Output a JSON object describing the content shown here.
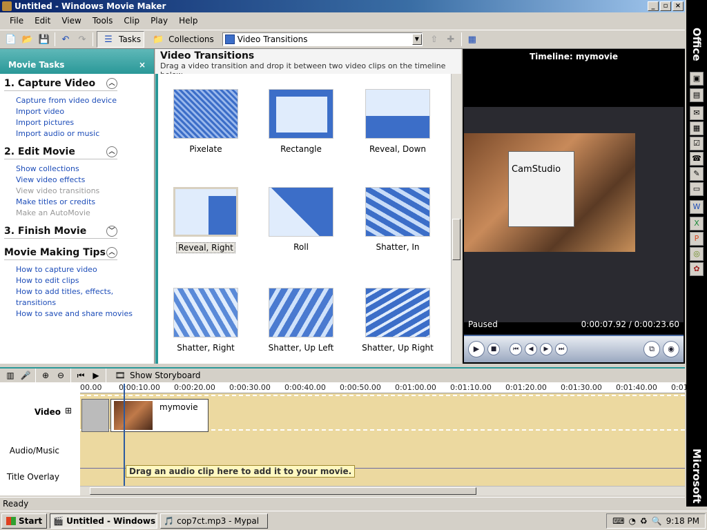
{
  "window": {
    "title": "Untitled - Windows Movie Maker"
  },
  "menu": [
    "File",
    "Edit",
    "View",
    "Tools",
    "Clip",
    "Play",
    "Help"
  ],
  "toolbar": {
    "tasks_label": "Tasks",
    "collections_label": "Collections",
    "collection_select": "Video Transitions"
  },
  "task_pane": {
    "title": "Movie Tasks",
    "close": "×",
    "groups": [
      {
        "title": "1. Capture Video",
        "links": [
          "Capture from video device",
          "Import video",
          "Import pictures",
          "Import audio or music"
        ]
      },
      {
        "title": "2. Edit Movie",
        "links": [
          "Show collections",
          "View video effects",
          "View video transitions",
          "Make titles or credits",
          "Make an AutoMovie"
        ]
      },
      {
        "title": "3. Finish Movie"
      },
      {
        "title": "Movie Making Tips",
        "links": [
          "How to capture video",
          "How to edit clips",
          "How to add titles, effects, transitions",
          "How to save and share movies"
        ]
      }
    ]
  },
  "content": {
    "title": "Video Transitions",
    "description": "Drag a video transition and drop it between two video clips on the timeline below.",
    "transitions": [
      "Pixelate",
      "Rectangle",
      "Reveal, Down",
      "Reveal, Right",
      "Roll",
      "Shatter, In",
      "Shatter, Right",
      "Shatter, Up Left",
      "Shatter, Up Right"
    ],
    "selected": "Reveal, Right"
  },
  "monitor": {
    "title": "Timeline: mymovie",
    "status": "Paused",
    "time": "0:00:07.92 / 0:00:23.60",
    "screen_text": "CamStudio"
  },
  "office_bar": {
    "top_label": "Office",
    "bottom_label": "Microsoft"
  },
  "timeline": {
    "toolbar_label": "Show Storyboard",
    "ruler": [
      "00.00",
      "0:00:10.00",
      "0:00:20.00",
      "0:00:30.00",
      "0:00:40.00",
      "0:00:50.00",
      "0:01:00.00",
      "0:01:10.00",
      "0:01:20.00",
      "0:01:30.00",
      "0:01:40.00",
      "0:01"
    ],
    "tracks": {
      "video": "Video",
      "audio": "Audio/Music",
      "title": "Title Overlay"
    },
    "clip_name": "mymovie",
    "tooltip": "Drag an audio clip here to add it to your movie."
  },
  "statusbar": {
    "text": "Ready"
  },
  "taskbar": {
    "start": "Start",
    "task1": "Untitled - Windows ...",
    "task2": "cop7ct.mp3 - Mypal",
    "clock": "9:18 PM"
  }
}
